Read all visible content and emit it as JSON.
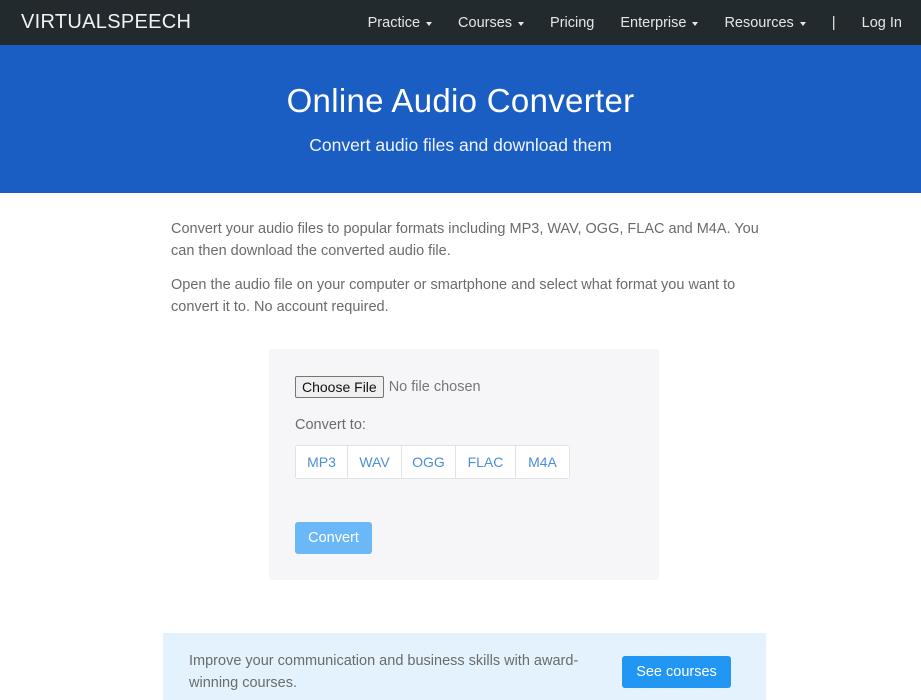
{
  "navbar": {
    "brand": "VIRTUALSPEECH",
    "items": [
      {
        "label": "Practice",
        "has_dropdown": true
      },
      {
        "label": "Courses",
        "has_dropdown": true
      },
      {
        "label": "Pricing",
        "has_dropdown": false
      },
      {
        "label": "Enterprise",
        "has_dropdown": true
      },
      {
        "label": "Resources",
        "has_dropdown": true
      }
    ],
    "divider": "|",
    "login_label": "Log In"
  },
  "hero": {
    "title": "Online Audio Converter",
    "subtitle": "Convert audio files and download them",
    "background_color": "#1a5ec4"
  },
  "intro": {
    "paragraphs": [
      "Convert your audio files to popular formats including MP3, WAV, OGG, FLAC and M4A. You can then download the converted audio file.",
      "Open the audio file on your computer or smartphone and select what format you want to convert it to. No account required."
    ]
  },
  "converter": {
    "choose_file_label": "Choose File",
    "file_status": "No file chosen",
    "convert_to_label": "Convert to:",
    "formats": [
      "MP3",
      "WAV",
      "OGG",
      "FLAC",
      "M4A"
    ],
    "convert_button_label": "Convert",
    "convert_button_color": "#6bb8f8"
  },
  "cta": {
    "text": "Improve your communication and business skills with award-winning courses.",
    "button_label": "See courses",
    "button_color": "#2196f3"
  }
}
